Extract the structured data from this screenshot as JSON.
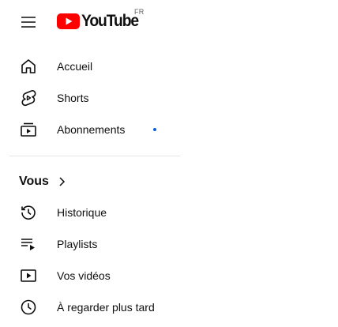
{
  "header": {
    "logo_text": "YouTube",
    "country_code": "FR",
    "brand_color": "#ff0000"
  },
  "nav_primary": [
    {
      "label": "Accueil",
      "icon": "home-icon"
    },
    {
      "label": "Shorts",
      "icon": "shorts-icon"
    },
    {
      "label": "Abonnements",
      "icon": "subscriptions-icon",
      "has_new_dot": true
    }
  ],
  "you_section": {
    "title": "Vous",
    "items": [
      {
        "label": "Historique",
        "icon": "history-icon"
      },
      {
        "label": "Playlists",
        "icon": "playlists-icon"
      },
      {
        "label": "Vos vidéos",
        "icon": "your-videos-icon"
      },
      {
        "label": "À regarder plus tard",
        "icon": "watch-later-icon"
      }
    ]
  },
  "colors": {
    "text": "#0f0f0f",
    "new_dot": "#065fd4",
    "divider": "#e5e5e5"
  }
}
